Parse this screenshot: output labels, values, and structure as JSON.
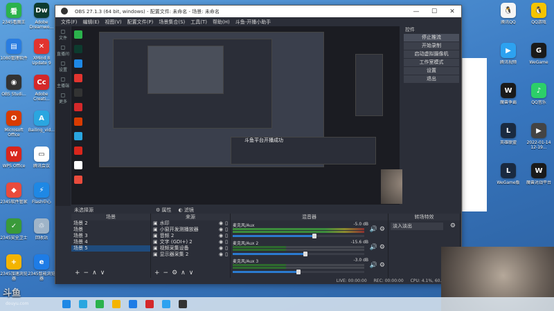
{
  "desktop": {
    "left_icons": [
      {
        "label": "2345看图王",
        "color": "#2bb24c",
        "glyph": "看"
      },
      {
        "label": "Adobe Dreamwe...",
        "color": "#0d3b2e",
        "glyph": "Dw"
      },
      {
        "label": "1080管理软件",
        "color": "#2a7de1",
        "glyph": "▤"
      },
      {
        "label": "XMind 8 Update 9",
        "color": "#e2342f",
        "glyph": "✕"
      },
      {
        "label": "OBS Studi...",
        "color": "#333333",
        "glyph": "◉"
      },
      {
        "label": "Adobe Creati...",
        "color": "#d4282a",
        "glyph": "Cc"
      },
      {
        "label": "Microsoft Office",
        "color": "#d83b01",
        "glyph": "O"
      },
      {
        "label": "Bailing_vid...",
        "color": "#2aa6e0",
        "glyph": "A"
      },
      {
        "label": "WPS Office",
        "color": "#d9261c",
        "glyph": "W"
      },
      {
        "label": "腾讯会议",
        "color": "#ffffff",
        "glyph": "▭"
      },
      {
        "label": "2345软件管家",
        "color": "#e94b3c",
        "glyph": "◆"
      },
      {
        "label": "Flash中心",
        "color": "#1e88e5",
        "glyph": "⚡"
      },
      {
        "label": "2345安全卫士",
        "color": "#3a9a3a",
        "glyph": "✓"
      },
      {
        "label": "回收站",
        "color": "#9fb4c8",
        "glyph": "♲"
      },
      {
        "label": "2345加速浏览器",
        "color": "#f4b400",
        "glyph": "+"
      },
      {
        "label": "2345智能浏览器",
        "color": "#1e7ce6",
        "glyph": "e"
      }
    ],
    "right_icons": [
      {
        "label": "腾讯QQ",
        "color": "#f5f5f5",
        "glyph": "🐧"
      },
      {
        "label": "QQ游戏",
        "color": "#f5c400",
        "glyph": "🐧"
      },
      {
        "label": "腾讯视频",
        "color": "#2da2f0",
        "glyph": "▶"
      },
      {
        "label": "WeGame",
        "color": "#1a1a1a",
        "glyph": "G"
      },
      {
        "label": "魔兽争霸",
        "color": "#1a1a1a",
        "glyph": "W"
      },
      {
        "label": "QQ音乐",
        "color": "#2ccf69",
        "glyph": "♪"
      },
      {
        "label": "英雄联盟",
        "color": "#1a2a40",
        "glyph": "L"
      },
      {
        "label": "2022-01-14 12-19...",
        "color": "#444444",
        "glyph": "▶"
      },
      {
        "label": "WeGame版",
        "color": "#1a2a40",
        "glyph": "L"
      },
      {
        "label": "魔兽对战平台",
        "color": "#1a1a1a",
        "glyph": "W"
      }
    ],
    "watermark": "斗鱼",
    "watermark_url": "douyu.com"
  },
  "obs": {
    "title": "OBS 27.1.3 (64 bit, windows) - 配置文件: 未命名 - 场景: 未命名",
    "menu": [
      "文件(F)",
      "编辑(E)",
      "视图(V)",
      "配置文件(P)",
      "场景集合(S)",
      "工具(T)",
      "帮助(H)",
      "斗鱼-开播小助手"
    ],
    "left_strip": [
      "文件",
      "直播间",
      "设置",
      "主播端",
      "更多"
    ],
    "preview_toast": "斗鱼平台开播成功",
    "controls": {
      "title": "控件",
      "buttons": [
        "停止推流",
        "开始录制",
        "启动虚拟摄像机",
        "工作室模式",
        "设置",
        "退出"
      ]
    },
    "no_source": "未选择源",
    "properties_button": "属性",
    "filters_button": "滤镜",
    "scenes": {
      "title": "场景",
      "items": [
        "场景 2",
        "场景",
        "场景 3",
        "场景 4",
        "场景 5"
      ],
      "selected": 4
    },
    "sources": {
      "title": "来源",
      "items": [
        "水印",
        "小窗开发测播放器",
        "音频 2",
        "文字 (GDI+) 2",
        "视频采集设备",
        "显示器采集 2"
      ]
    },
    "mixer": {
      "title": "混音器",
      "channels": [
        {
          "name": "麦克风/Aux",
          "db": "-5.0 dB",
          "level": 0.62
        },
        {
          "name": "麦克风/Aux 2",
          "db": "-15.6 dB",
          "level": 0.55
        },
        {
          "name": "麦克风/Aux 3",
          "db": "-3.0 dB",
          "level": 0.5
        }
      ]
    },
    "transitions": {
      "title": "转场特效",
      "value": "淡入淡出"
    },
    "status": {
      "live": "LIVE: 00:00:00",
      "rec": "REC: 00:00:00",
      "cpu": "CPU: 4.1%, 60.00 fps"
    }
  },
  "colors": {
    "obs_bg": "#2b2e38",
    "accent": "#2b7bd0"
  }
}
